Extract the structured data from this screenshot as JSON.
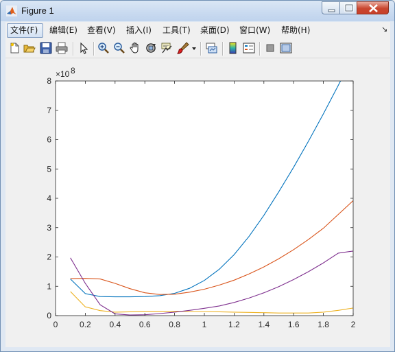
{
  "window": {
    "title": "Figure 1"
  },
  "menu": {
    "items": [
      "文件(F)",
      "编辑(E)",
      "查看(V)",
      "插入(I)",
      "工具(T)",
      "桌面(D)",
      "窗口(W)",
      "帮助(H)"
    ],
    "overflow": "↘"
  },
  "toolbar": {
    "icons": [
      "new-figure-icon",
      "open-icon",
      "save-icon",
      "print-icon",
      "pointer-icon",
      "zoom-in-icon",
      "zoom-out-icon",
      "pan-icon",
      "rotate-icon",
      "data-cursor-icon",
      "brush-icon",
      "dropdown-icon",
      "link-icon",
      "colorbar-icon",
      "legend-icon",
      "hide-plot-tools-icon",
      "show-plot-tools-icon"
    ]
  },
  "colors": {
    "series1": "#0072bd",
    "series2": "#d95319",
    "series3": "#edb120",
    "series4": "#7e2f8e"
  },
  "chart_data": {
    "type": "line",
    "exponent_label": "×10",
    "exponent_power": "8",
    "xlim": [
      0,
      2
    ],
    "ylim": [
      0,
      8
    ],
    "xticks": [
      "0",
      "0.2",
      "0.4",
      "0.6",
      "0.8",
      "1",
      "1.2",
      "1.4",
      "1.6",
      "1.8",
      "2"
    ],
    "yticks": [
      "0",
      "1",
      "2",
      "3",
      "4",
      "5",
      "6",
      "7",
      "8"
    ],
    "grid": false,
    "x": [
      0.1,
      0.2,
      0.3,
      0.4,
      0.5,
      0.6,
      0.7,
      0.8,
      0.9,
      1.0,
      1.1,
      1.2,
      1.3,
      1.4,
      1.5,
      1.6,
      1.7,
      1.8,
      1.9,
      2.0
    ],
    "series": [
      {
        "color": "#0072bd",
        "values": [
          1.25,
          0.75,
          0.65,
          0.64,
          0.64,
          0.65,
          0.68,
          0.76,
          0.93,
          1.2,
          1.58,
          2.08,
          2.7,
          3.42,
          4.22,
          5.06,
          5.95,
          6.88,
          7.85,
          8.85
        ]
      },
      {
        "color": "#d95319",
        "values": [
          1.26,
          1.27,
          1.25,
          1.1,
          0.92,
          0.78,
          0.72,
          0.73,
          0.8,
          0.9,
          1.04,
          1.21,
          1.42,
          1.66,
          1.94,
          2.25,
          2.6,
          2.98,
          3.45,
          3.92
        ]
      },
      {
        "color": "#edb120",
        "values": [
          0.82,
          0.3,
          0.17,
          0.12,
          0.13,
          0.15,
          0.15,
          0.15,
          0.14,
          0.14,
          0.13,
          0.12,
          0.11,
          0.1,
          0.09,
          0.09,
          0.09,
          0.12,
          0.18,
          0.26
        ]
      },
      {
        "color": "#7e2f8e",
        "values": [
          1.97,
          1.1,
          0.37,
          0.06,
          0.02,
          0.03,
          0.07,
          0.12,
          0.18,
          0.25,
          0.33,
          0.45,
          0.6,
          0.78,
          0.99,
          1.23,
          1.5,
          1.8,
          2.13,
          2.2
        ]
      }
    ]
  }
}
